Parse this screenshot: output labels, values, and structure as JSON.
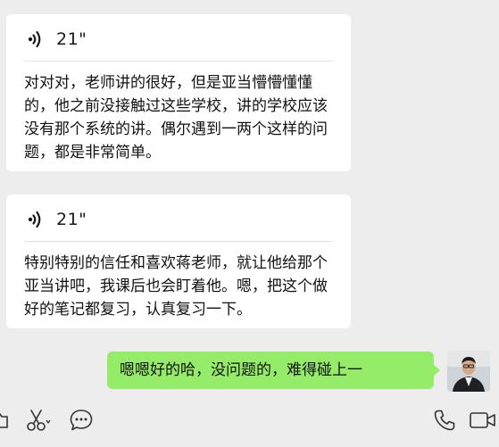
{
  "messages": [
    {
      "type": "voice",
      "duration": "21\"",
      "text": "对对对，老师讲的很好，但是亚当懵懵懂懂的，他之前没接触过这些学校，讲的学校应该没有那个系统的讲。偶尔遇到一两个这样的问题，都是非常简单。"
    },
    {
      "type": "voice",
      "duration": "21\"",
      "text": "特别特别的信任和喜欢蒋老师，就让他给那个亚当讲吧，我课后也会盯着他。嗯，把这个做好的笔记都复习，认真复习一下。"
    }
  ],
  "outgoing": {
    "text": "嗯嗯好的哈，没问题的，难得碰上一"
  },
  "colors": {
    "background": "#ededed",
    "bubble_in": "#ffffff",
    "bubble_out": "#95ec69",
    "text": "#111111"
  },
  "toolbar": {
    "icons": [
      "folder-icon",
      "scissors-icon",
      "chat-bubble-icon",
      "phone-icon",
      "video-call-icon"
    ]
  }
}
